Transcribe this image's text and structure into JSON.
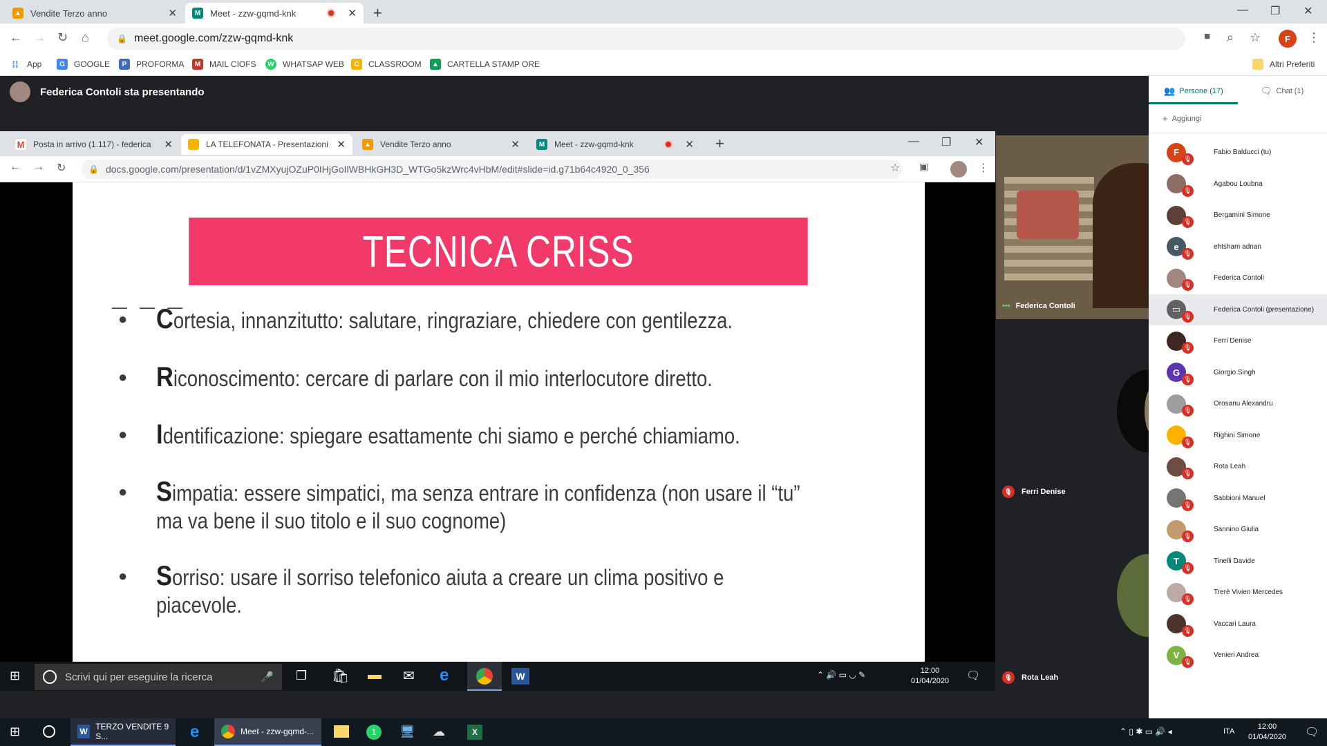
{
  "outer_tabs": [
    {
      "label": "Vendite Terzo anno",
      "color": "#f29900",
      "glyph": "▲"
    },
    {
      "label": "Meet - zzw-gqmd-knk",
      "color": "#00897b",
      "glyph": "M"
    }
  ],
  "outer_url": "meet.google.com/zzw-gqmd-knk",
  "profile_initial": "F",
  "bookmarks": [
    {
      "label": "App",
      "color": "#4285f4",
      "glyph": "⋮"
    },
    {
      "label": "GOOGLE",
      "color": "#4285f4",
      "glyph": "G"
    },
    {
      "label": "PROFORMA",
      "color": "#3f6bb5",
      "glyph": "P"
    },
    {
      "label": "MAIL CIOFS",
      "color": "#c0392b",
      "glyph": "M"
    },
    {
      "label": "WHATSAP WEB",
      "color": "#25d366",
      "glyph": "W"
    },
    {
      "label": "CLASSROOM",
      "color": "#f4b400",
      "glyph": "C"
    },
    {
      "label": "CARTELLA STAMP ORE",
      "color": "#0f9d58",
      "glyph": "▲"
    }
  ],
  "other_bookmarks": "Altri Preferiti",
  "presenting_label": "Federica Contoli sta presentando",
  "inner_tabs": [
    {
      "label": "Posta in arrivo (1.117) - federica",
      "color": "#ea4335",
      "glyph": "M"
    },
    {
      "label": "LA TELEFONATA - Presentazioni G",
      "color": "#f4b400",
      "glyph": "▭"
    },
    {
      "label": "Vendite Terzo anno",
      "color": "#f29900",
      "glyph": "▲"
    },
    {
      "label": "Meet - zzw-gqmd-knk",
      "color": "#00897b",
      "glyph": "M"
    }
  ],
  "inner_url": "docs.google.com/presentation/d/1vZMXyujOZuP0IHjGoIlWBHkGH3D_WTGo5kzWrc4vHbM/edit#slide=id.g71b64c4920_0_356",
  "slide": {
    "title": "TECNICA CRISS",
    "bullets": [
      {
        "cap": "C",
        "text": "ortesia, innanzitutto: salutare, ringraziare, chiedere con gentilezza."
      },
      {
        "cap": "R",
        "text": "iconoscimento: cercare di parlare con il mio interlocutore diretto."
      },
      {
        "cap": "I",
        "text": "dentificazione: spiegare esattamente chi siamo e perché chiamiamo."
      },
      {
        "cap": "S",
        "text": "impatia: essere simpatici, ma senza entrare in confidenza (non usare il “tu” ma va bene il suo titolo e il suo cognome)"
      },
      {
        "cap": "S",
        "text": "orriso: usare il sorriso telefonico aiuta a creare un clima positivo e piacevole."
      }
    ]
  },
  "inner_search_placeholder": "Scrivi qui per eseguire la ricerca",
  "inner_clock": {
    "time": "12:00",
    "date": "01/04/2020"
  },
  "tiles": {
    "tile1": "Federica Contoli",
    "tile2": "Ferri Denise",
    "tile3": "Rota Leah"
  },
  "panel": {
    "people_tab": "Persone (17)",
    "chat_tab": "Chat (1)",
    "add_label": "Aggiungi",
    "participants": [
      {
        "name": "Fabio Balducci (tu)",
        "initial": "F",
        "color": "#d84315"
      },
      {
        "name": "Agabou Loubna",
        "initial": "",
        "color": "#8d6e63"
      },
      {
        "name": "Bergamini Simone",
        "initial": "",
        "color": "#5d4037"
      },
      {
        "name": "ehtsham adnan",
        "initial": "e",
        "color": "#455a64"
      },
      {
        "name": "Federica Contoli",
        "initial": "",
        "color": "#a1887f"
      },
      {
        "name": "Federica Contoli (presentazione)",
        "initial": "▭",
        "color": "#616161"
      },
      {
        "name": "Ferri Denise",
        "initial": "",
        "color": "#3e2723"
      },
      {
        "name": "Giorgio Singh",
        "initial": "G",
        "color": "#5e35b1"
      },
      {
        "name": "Orosanu Alexandru",
        "initial": "",
        "color": "#9e9e9e"
      },
      {
        "name": "Righini Simone",
        "initial": "",
        "color": "#ffb300"
      },
      {
        "name": "Rota Leah",
        "initial": "",
        "color": "#6d4c41"
      },
      {
        "name": "Sabbioni Manuel",
        "initial": "",
        "color": "#757575"
      },
      {
        "name": "Sannino Giulia",
        "initial": "",
        "color": "#c49a6c"
      },
      {
        "name": "Tinelli Davide",
        "initial": "T",
        "color": "#00897b"
      },
      {
        "name": "Trerè Vivien Mercedes",
        "initial": "",
        "color": "#bcaaa4"
      },
      {
        "name": "Vaccari Laura",
        "initial": "",
        "color": "#4e342e"
      },
      {
        "name": "Venieri Andrea",
        "initial": "V",
        "color": "#7cb342"
      }
    ]
  },
  "taskbar": {
    "word_label": "TERZO VENDITE 9 S...",
    "chrome_label": "Meet - zzw-gqmd-...",
    "lang": "ITA",
    "time": "12:00",
    "date": "01/04/2020"
  }
}
